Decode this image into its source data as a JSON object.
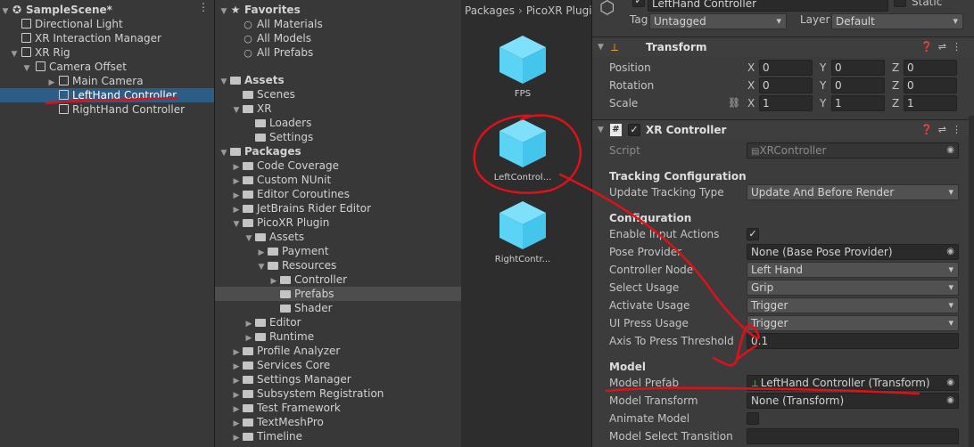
{
  "hierarchy": {
    "scene_name": "SampleScene*",
    "items": [
      {
        "label": "Directional Light"
      },
      {
        "label": "XR Interaction Manager"
      },
      {
        "label": "XR Rig"
      },
      {
        "label": "Camera Offset"
      },
      {
        "label": "Main Camera"
      },
      {
        "label": "LeftHand Controller",
        "selected": true
      },
      {
        "label": "RightHand Controller"
      }
    ]
  },
  "project_tree": {
    "favorites": {
      "label": "Favorites",
      "items": [
        "All Materials",
        "All Models",
        "All Prefabs"
      ]
    },
    "assets": {
      "label": "Assets",
      "items": [
        "Scenes",
        "XR",
        "Loaders",
        "Settings"
      ]
    },
    "packages": {
      "label": "Packages",
      "items": [
        "Code Coverage",
        "Custom NUnit",
        "Editor Coroutines",
        "JetBrains Rider Editor",
        "PicoXR Plugin",
        "Assets",
        "Payment",
        "Resources",
        "Controller",
        "Prefabs",
        "Shader",
        "Editor",
        "Runtime",
        "Profile Analyzer",
        "Services Core",
        "Settings Manager",
        "Subsystem Registration",
        "Test Framework",
        "TextMeshPro",
        "Timeline"
      ]
    }
  },
  "project_grid": {
    "breadcrumb": [
      "Packages",
      "PicoXR Plugi"
    ],
    "assets": [
      "FPS",
      "LeftControl...",
      "RightContr..."
    ]
  },
  "inspector": {
    "object_name": "LeftHand Controller",
    "static_label": "Static",
    "tag_label": "Tag",
    "tag_value": "Untagged",
    "layer_label": "Layer",
    "layer_value": "Default",
    "transform": {
      "title": "Transform",
      "position_label": "Position",
      "rotation_label": "Rotation",
      "scale_label": "Scale",
      "axis_x": "X",
      "axis_y": "Y",
      "axis_z": "Z",
      "position": [
        "0",
        "0",
        "0"
      ],
      "rotation": [
        "0",
        "0",
        "0"
      ],
      "scale": [
        "1",
        "1",
        "1"
      ]
    },
    "xr_controller": {
      "title": "XR Controller",
      "script_label": "Script",
      "script_value": "XRController",
      "tracking_section": "Tracking Configuration",
      "update_tracking_type_label": "Update Tracking Type",
      "update_tracking_type_value": "Update And Before Render",
      "configuration_section": "Configuration",
      "enable_input_actions_label": "Enable Input Actions",
      "enable_input_actions_checked": true,
      "check_glyph": "✓",
      "pose_provider_label": "Pose Provider",
      "pose_provider_value": "None (Base Pose Provider)",
      "controller_node_label": "Controller Node",
      "controller_node_value": "Left Hand",
      "select_usage_label": "Select Usage",
      "select_usage_value": "Grip",
      "activate_usage_label": "Activate Usage",
      "activate_usage_value": "Trigger",
      "ui_press_usage_label": "UI Press Usage",
      "ui_press_usage_value": "Trigger",
      "axis_threshold_label": "Axis To Press Threshold",
      "axis_threshold_value": "0.1",
      "model_section": "Model",
      "model_prefab_label": "Model Prefab",
      "model_prefab_value": "LeftHand Controller (Transform)",
      "model_transform_label": "Model Transform",
      "model_transform_value": "None (Transform)",
      "animate_model_label": "Animate Model",
      "animate_model_checked": false,
      "model_select_transition_label": "Model Select Transition",
      "model_select_transition_value": ""
    }
  },
  "colors": {
    "selection": "#2c5d87",
    "annotation_red": "#e0101a",
    "asset_cube": "#5ad3f5"
  }
}
